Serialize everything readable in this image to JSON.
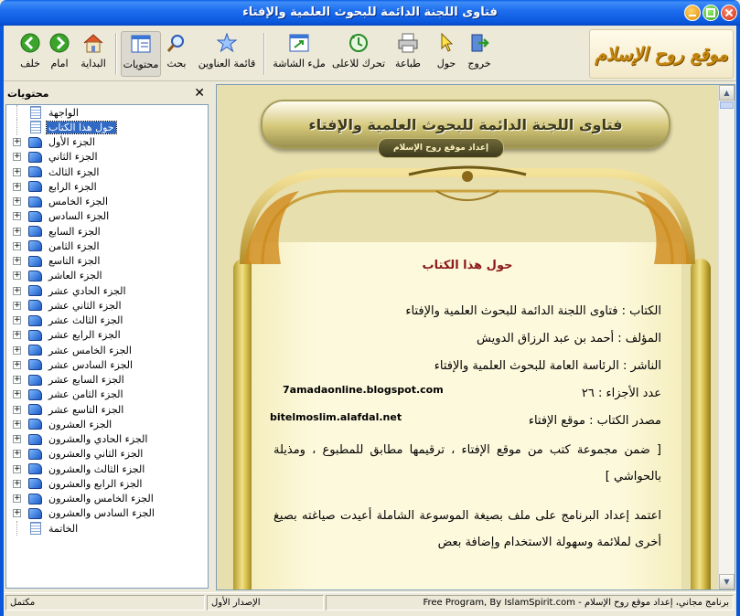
{
  "window": {
    "title": "فتاوى اللجنة الدائمة للبحوث العلمية والإفتاء"
  },
  "toolbar": {
    "buttons": [
      {
        "label": "خلف",
        "icon": "back-arrow-icon"
      },
      {
        "label": "امام",
        "icon": "forward-arrow-icon"
      },
      {
        "label": "البداية",
        "icon": "home-icon"
      },
      {
        "label": "محتويات",
        "icon": "contents-icon"
      },
      {
        "label": "بحث",
        "icon": "search-icon"
      },
      {
        "label": "قائمة العناوين",
        "icon": "star-icon"
      },
      {
        "label": "ملء الشاشة",
        "icon": "fullscreen-icon"
      },
      {
        "label": "تحرك للاعلى",
        "icon": "sync-up-icon"
      },
      {
        "label": "طباعة",
        "icon": "print-icon"
      },
      {
        "label": "حول",
        "icon": "about-pointer-icon"
      },
      {
        "label": "خروج",
        "icon": "exit-icon"
      }
    ],
    "logo_text": "موقع روح الإسلام"
  },
  "sidebar": {
    "title": "محتويات",
    "items": [
      {
        "label": "الواجهة",
        "type": "page",
        "expandable": false
      },
      {
        "label": "حول هذا الكتاب",
        "type": "page",
        "expandable": false,
        "selected": true
      },
      {
        "label": "الجزء الأول",
        "type": "book",
        "expandable": true
      },
      {
        "label": "الجزء الثاني",
        "type": "book",
        "expandable": true
      },
      {
        "label": "الجزء الثالث",
        "type": "book",
        "expandable": true
      },
      {
        "label": "الجزء الرابع",
        "type": "book",
        "expandable": true
      },
      {
        "label": "الجزء الخامس",
        "type": "book",
        "expandable": true
      },
      {
        "label": "الجزء السادس",
        "type": "book",
        "expandable": true
      },
      {
        "label": "الجزء السابع",
        "type": "book",
        "expandable": true
      },
      {
        "label": "الجزء الثامن",
        "type": "book",
        "expandable": true
      },
      {
        "label": "الجزء التاسع",
        "type": "book",
        "expandable": true
      },
      {
        "label": "الجزء العاشر",
        "type": "book",
        "expandable": true
      },
      {
        "label": "الجزء الحادي عشر",
        "type": "book",
        "expandable": true
      },
      {
        "label": "الجزء الثاني عشر",
        "type": "book",
        "expandable": true
      },
      {
        "label": "الجزء الثالث عشر",
        "type": "book",
        "expandable": true
      },
      {
        "label": "الجزء الرابع عشر",
        "type": "book",
        "expandable": true
      },
      {
        "label": "الجزء الخامس عشر",
        "type": "book",
        "expandable": true
      },
      {
        "label": "الجزء السادس عشر",
        "type": "book",
        "expandable": true
      },
      {
        "label": "الجزء السابع عشر",
        "type": "book",
        "expandable": true
      },
      {
        "label": "الجزء الثامن عشر",
        "type": "book",
        "expandable": true
      },
      {
        "label": "الجزء التاسع عشر",
        "type": "book",
        "expandable": true
      },
      {
        "label": "الجزء العشرون",
        "type": "book",
        "expandable": true
      },
      {
        "label": "الجزء الحادي والعشرون",
        "type": "book",
        "expandable": true
      },
      {
        "label": "الجزء الثاني والعشرون",
        "type": "book",
        "expandable": true
      },
      {
        "label": "الجزء الثالث والعشرون",
        "type": "book",
        "expandable": true
      },
      {
        "label": "الجزء الرابع والعشرون",
        "type": "book",
        "expandable": true
      },
      {
        "label": "الجزء الخامس والعشرون",
        "type": "book",
        "expandable": true
      },
      {
        "label": "الجزء السادس والعشرون",
        "type": "book",
        "expandable": true
      },
      {
        "label": "الخاتمة",
        "type": "page",
        "expandable": false
      }
    ]
  },
  "document": {
    "banner_title": "فتاوى اللجنة الدائمة للبحوث العلمية والإفتاء",
    "banner_subtitle": "إعداد موقع روح الإسلام",
    "heading": "حول هذا الكتاب",
    "book_line": "الكتاب : فتاوى اللجنة الدائمة للبحوث العلمية والإفتاء",
    "author_line": "المؤلف : أحمد بن عبد الرزاق الدويش",
    "publisher_line": "الناشر : الرئاسة العامة للبحوث العلمية والإفتاء",
    "parts_line": "عدد الأجزاء : ٢٦",
    "source_line": "مصدر الكتاب : موقع الإفتاء",
    "note_1": "7amadaonline.blogspot.com",
    "note_2": "bitelmoslim.alafdal.net",
    "bracket_text": "[ ضمن مجموعة كتب من موقع الإفتاء ، ترقيمها مطابق للمطبوع ، ومذيلة بالحواشي ]",
    "paragraph": "اعتمد إعداد البرنامج على ملف بصيغة الموسوعة الشاملة أعيدت صياغته بصيغ أخرى لملائمة وسهولة الاستخدام وإضافة بعض"
  },
  "status": {
    "state": "مكتمل",
    "version": "الإصدار الأول",
    "credit_en": "Free Program, By IslamSpirit.com - ",
    "credit_ar": "برنامج مجاني، إعداد موقع روح الإسلام"
  },
  "colors": {
    "titlebar": "#0a57db",
    "selection": "#316ac5",
    "heading": "#8b1a1a",
    "parchment": "#fdf9dd"
  }
}
